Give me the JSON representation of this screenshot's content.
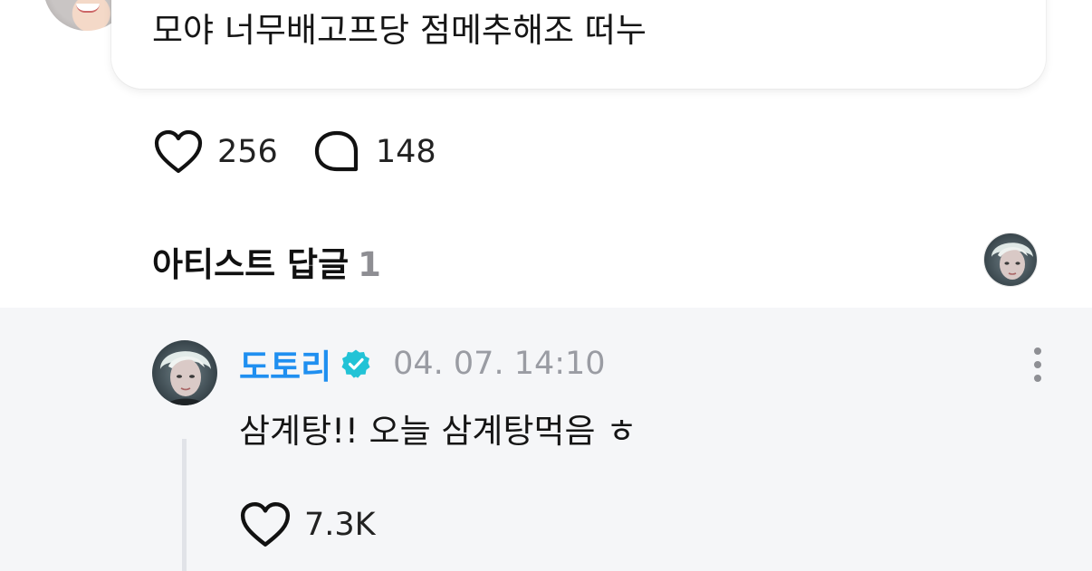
{
  "post": {
    "text": "모야 너무배고프당 점메추해조 떠누",
    "likes": "256",
    "comments": "148"
  },
  "artist_replies": {
    "title": "아티스트 답글",
    "count": "1"
  },
  "reply": {
    "author": "도토리",
    "verified": true,
    "timestamp": "04. 07. 14:10",
    "text": "삼계탕!! 오늘 삼계탕먹음 ㅎ",
    "likes": "7.3K"
  },
  "colors": {
    "author_name": "#1f8ff0",
    "verified_badge": "#22c3d6",
    "muted_text": "#9a9ca3",
    "reply_background": "#f5f6f8"
  },
  "icons": {
    "like": "heart-outline-icon",
    "comment": "chat-bubble-outline-icon",
    "verified": "verified-badge-icon",
    "more": "more-vertical-icon"
  }
}
